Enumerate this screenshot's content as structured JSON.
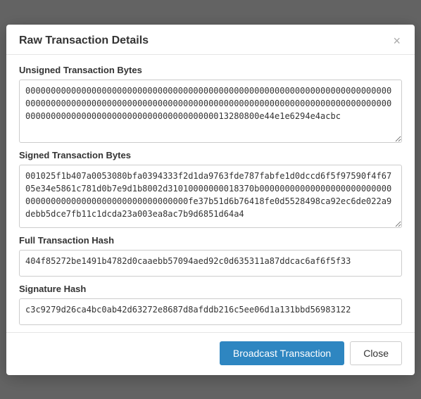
{
  "modal": {
    "title": "Raw Transaction Details",
    "close_label": "×",
    "sections": {
      "unsigned_label": "Unsigned Transaction Bytes",
      "unsigned_value": "0000000000000000000000000000000000000000000000000000000000000000000000000000000000000000000000000000000000000000000000000000000000000000000000000000000000000000000000000000000000000013280800e44e1e6294e4acbc",
      "signed_label": "Signed Transaction Bytes",
      "signed_value": "001025f1b407a0053080bfa0394333f2d1da9763fde787fabfe1d0dccd6f5f97590f4f6705e34e5861c781d0b7e9d1b8002d31010000000018370b0000000000000000000000000000000000000000000000000000000000fe37b51d6b76418fe0d5528498ca92ec6de022a9debb5dce7fb11c1dcda23a003ea8ac7b9d6851d64a4",
      "full_hash_label": "Full Transaction Hash",
      "full_hash_value": "404f85272be1491b4782d0caaebb57094aed92c0d635311a87ddcac6af6f5f33",
      "sig_hash_label": "Signature Hash",
      "sig_hash_value": "c3c9279d26ca4bc0ab42d63272e8687d8afddb216c5ee06d1a131bbd56983122"
    },
    "footer": {
      "broadcast_label": "Broadcast Transaction",
      "close_label": "Close"
    }
  }
}
